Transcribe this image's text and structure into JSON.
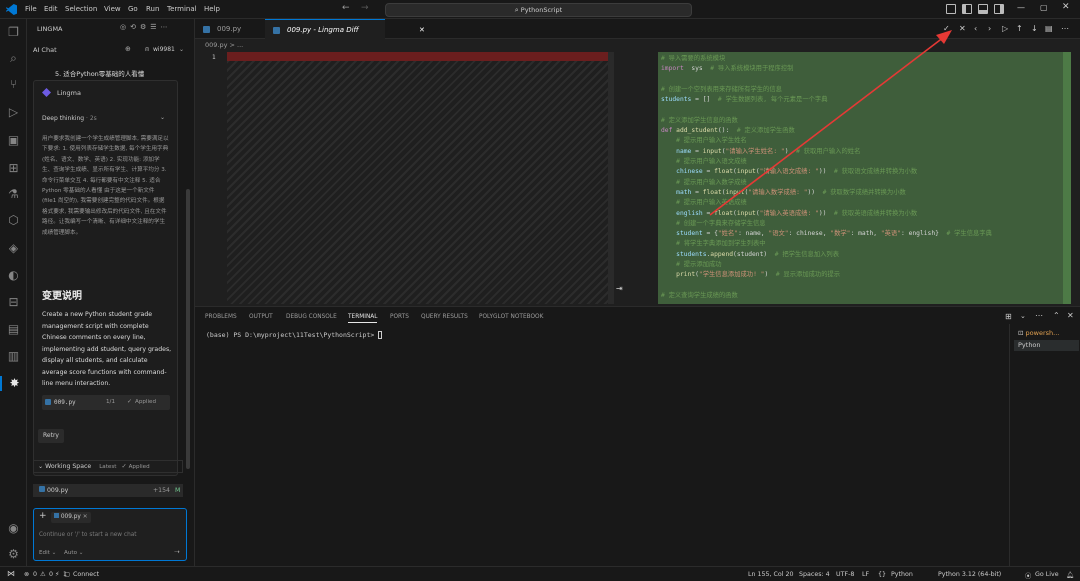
{
  "menu": [
    "File",
    "Edit",
    "Selection",
    "View",
    "Go",
    "Run",
    "Terminal",
    "Help"
  ],
  "search": {
    "text": "PythonScript"
  },
  "activity_icons": [
    "explorer-icon",
    "search-icon",
    "source-control-icon",
    "run-debug-icon",
    "remote-icon",
    "extensions-icon",
    "testing-icon",
    "database-icon",
    "python-icon",
    "edge-icon",
    "container-icon",
    "lingma-icon"
  ],
  "side": {
    "header": "LINGMA",
    "ai_chat": "AI Chat",
    "user": "wi9981",
    "top_item": "5. 适合Python零基础的人看懂",
    "assistant_name": "Lingma",
    "deep_thinking": "Deep thinking",
    "deep_time": "· 2s",
    "thinking_text": "用户要求我创建一个学生成绩管理脚本, 需要满足以下要求: 1. 使用列表存储学生数据, 每个学生用字典 (姓名、语文、数学、英语) 2. 实现功能: 添加学生、查询学生成绩、显示所有学生、计算平均分 3. 命令行菜单交互 4. 每行都要有中文注释 5. 适合 Python 零基础的人看懂 由于这是一个新文件 (file1 尚空的), 我需要创建完整的代码文件。根据格式要求, 我需要输出修改后的代码文件, 且在文件路径。让我编写一个清晰、有详细中文注释的学生成绩管理脚本。",
    "change_title": "变更说明",
    "change_desc": "Create a new Python student grade management script with complete Chinese comments on every line, implementing add student, query grades, display all students, and calculate average score functions with command-line menu interaction.",
    "file_name": "009.py",
    "file_count": "1/1",
    "applied": "Applied",
    "retry": "Retry",
    "working_space": "Working Space",
    "latest": "Latest",
    "applied2": "Applied",
    "ws_file": "009.py",
    "ws_add": "+154",
    "ws_m": "M",
    "chip": "009.py",
    "input_placeholder": "Continue or '/' to start a new chat",
    "edit": "Edit",
    "auto": "Auto"
  },
  "tabs": [
    {
      "label": "009.py",
      "active": false
    },
    {
      "label": "009.py - Lingma Diff",
      "active": true
    }
  ],
  "breadcrumb": "009.py > ...",
  "code_lines": [
    {
      "t": "cm",
      "s": "# 导入需要的系统模块"
    },
    {
      "t": "mix",
      "parts": [
        [
          "kw",
          "import"
        ],
        [
          "",
          "  sys  "
        ],
        [
          "cm",
          "# 导入系统模块用于程序控制"
        ]
      ]
    },
    {
      "t": "",
      "s": ""
    },
    {
      "t": "cm",
      "s": "# 创建一个空列表用来存储所有学生的信息"
    },
    {
      "t": "mix",
      "parts": [
        [
          "va",
          "students"
        ],
        [
          "",
          " = []  "
        ],
        [
          "cm",
          "# 学生数据列表, 每个元素是一个字典"
        ]
      ]
    },
    {
      "t": "",
      "s": ""
    },
    {
      "t": "cm",
      "s": "# 定义添加学生信息的函数"
    },
    {
      "t": "mix",
      "parts": [
        [
          "kw",
          "def"
        ],
        [
          "",
          " "
        ],
        [
          "fn",
          "add_student"
        ],
        [
          "",
          "():  "
        ],
        [
          "cm",
          "# 定义添加学生函数"
        ]
      ]
    },
    {
      "t": "cm",
      "s": "    # 提示用户输入学生姓名"
    },
    {
      "t": "mix",
      "parts": [
        [
          "va",
          "    name"
        ],
        [
          "",
          " = "
        ],
        [
          "fn",
          "input"
        ],
        [
          "",
          "("
        ],
        [
          "st",
          "\"请输入学生姓名: \""
        ],
        [
          "",
          ")  "
        ],
        [
          "cm",
          "# 获取用户输入的姓名"
        ]
      ]
    },
    {
      "t": "cm",
      "s": "    # 提示用户输入语文成绩"
    },
    {
      "t": "mix",
      "parts": [
        [
          "va",
          "    chinese"
        ],
        [
          "",
          " = "
        ],
        [
          "fn",
          "float"
        ],
        [
          "",
          "("
        ],
        [
          "fn",
          "input"
        ],
        [
          "",
          "("
        ],
        [
          "st",
          "\"请输入语文成绩: \""
        ],
        [
          "",
          "))  "
        ],
        [
          "cm",
          "# 获取语文成绩并转换为小数"
        ]
      ]
    },
    {
      "t": "cm",
      "s": "    # 提示用户输入数学成绩"
    },
    {
      "t": "mix",
      "parts": [
        [
          "va",
          "    math"
        ],
        [
          "",
          " = "
        ],
        [
          "fn",
          "float"
        ],
        [
          "",
          "("
        ],
        [
          "fn",
          "input"
        ],
        [
          "",
          "("
        ],
        [
          "st",
          "\"请输入数学成绩: \""
        ],
        [
          "",
          "))  "
        ],
        [
          "cm",
          "# 获取数学成绩并转换为小数"
        ]
      ]
    },
    {
      "t": "cm",
      "s": "    # 提示用户输入英语成绩"
    },
    {
      "t": "mix",
      "parts": [
        [
          "va",
          "    english"
        ],
        [
          "",
          " = "
        ],
        [
          "fn",
          "float"
        ],
        [
          "",
          "("
        ],
        [
          "fn",
          "input"
        ],
        [
          "",
          "("
        ],
        [
          "st",
          "\"请输入英语成绩: \""
        ],
        [
          "",
          "))  "
        ],
        [
          "cm",
          "# 获取英语成绩并转换为小数"
        ]
      ]
    },
    {
      "t": "cm",
      "s": "    # 创建一个字典来存储学生信息"
    },
    {
      "t": "mix",
      "parts": [
        [
          "va",
          "    student"
        ],
        [
          "",
          " = {"
        ],
        [
          "st",
          "\"姓名\""
        ],
        [
          "",
          ": name, "
        ],
        [
          "st",
          "\"语文\""
        ],
        [
          "",
          ": chinese, "
        ],
        [
          "st",
          "\"数学\""
        ],
        [
          "",
          ": math, "
        ],
        [
          "st",
          "\"英语\""
        ],
        [
          "",
          ": english}  "
        ],
        [
          "cm",
          "# 学生信息字典"
        ]
      ]
    },
    {
      "t": "cm",
      "s": "    # 将学生字典添加到学生列表中"
    },
    {
      "t": "mix",
      "parts": [
        [
          "va",
          "    students"
        ],
        [
          "",
          "."
        ],
        [
          "fn",
          "append"
        ],
        [
          "",
          "(student)  "
        ],
        [
          "cm",
          "# 把学生信息加入列表"
        ]
      ]
    },
    {
      "t": "cm",
      "s": "    # 提示添加成功"
    },
    {
      "t": "mix",
      "parts": [
        [
          "fn",
          "    print"
        ],
        [
          "",
          "("
        ],
        [
          "st",
          "\"学生信息添加成功! \""
        ],
        [
          "",
          ")  "
        ],
        [
          "cm",
          "# 显示添加成功的提示"
        ]
      ]
    },
    {
      "t": "",
      "s": ""
    },
    {
      "t": "cm",
      "s": "# 定义查询学生成绩的函数"
    }
  ],
  "panel_tabs": [
    "PROBLEMS",
    "OUTPUT",
    "DEBUG CONSOLE",
    "TERMINAL",
    "PORTS",
    "QUERY RESULTS",
    "POLYGLOT NOTEBOOK"
  ],
  "terminal_prompt": "(base) PS D:\\myproject\\11Test\\PythonScript> ",
  "terminals": [
    "powersh...",
    "Python"
  ],
  "status": {
    "errors": "0",
    "warnings": "0",
    "ports": "1",
    "connect": "Connect",
    "position": "Ln 155, Col 20",
    "spaces": "Spaces: 4",
    "encoding": "UTF-8",
    "eol": "LF",
    "language": "Python",
    "interpreter": "Python 3.12 (64-bit)",
    "golive": "Go Live"
  },
  "colors": {
    "accent": "#0078d4",
    "diff_added": "#3f5e3b",
    "diff_removed": "#6b1e1e",
    "arrow": "#e53935"
  }
}
